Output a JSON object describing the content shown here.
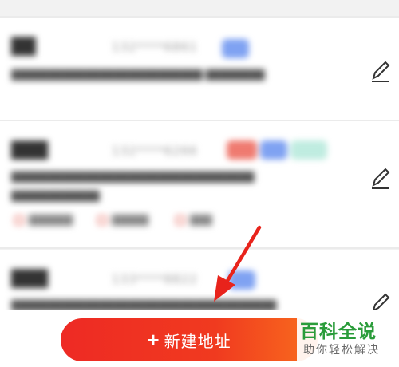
{
  "address_list": {
    "items": [
      {
        "name": "██",
        "phone": "132****6861",
        "address": "██████████████████████████ ████████",
        "tags": [
          "blue"
        ]
      },
      {
        "name": "███",
        "phone": "132****6266",
        "address": "█████████████████████████████████ ████████████",
        "tags": [
          "red",
          "blue",
          "teal"
        ],
        "labels": [
          "██████",
          "█████",
          "███"
        ]
      },
      {
        "name": "███",
        "phone": "133****8822",
        "address": "████████████████████████████████████",
        "tags": [
          "blue"
        ]
      }
    ]
  },
  "action": {
    "add_icon": "plus-icon",
    "add_label": "新建地址"
  },
  "watermark": {
    "title": "百科全说",
    "subtitle": "助你轻松解决"
  },
  "icons": {
    "edit": "pencil-icon",
    "annotation": "red-arrow"
  },
  "colors": {
    "button_start": "#ee2a24",
    "button_end": "#f96d1e",
    "arrow": "#e8231b",
    "watermark_green": "#2a9c3a",
    "tag_blue": "#7fa2f2",
    "tag_red": "#ef7a70"
  }
}
